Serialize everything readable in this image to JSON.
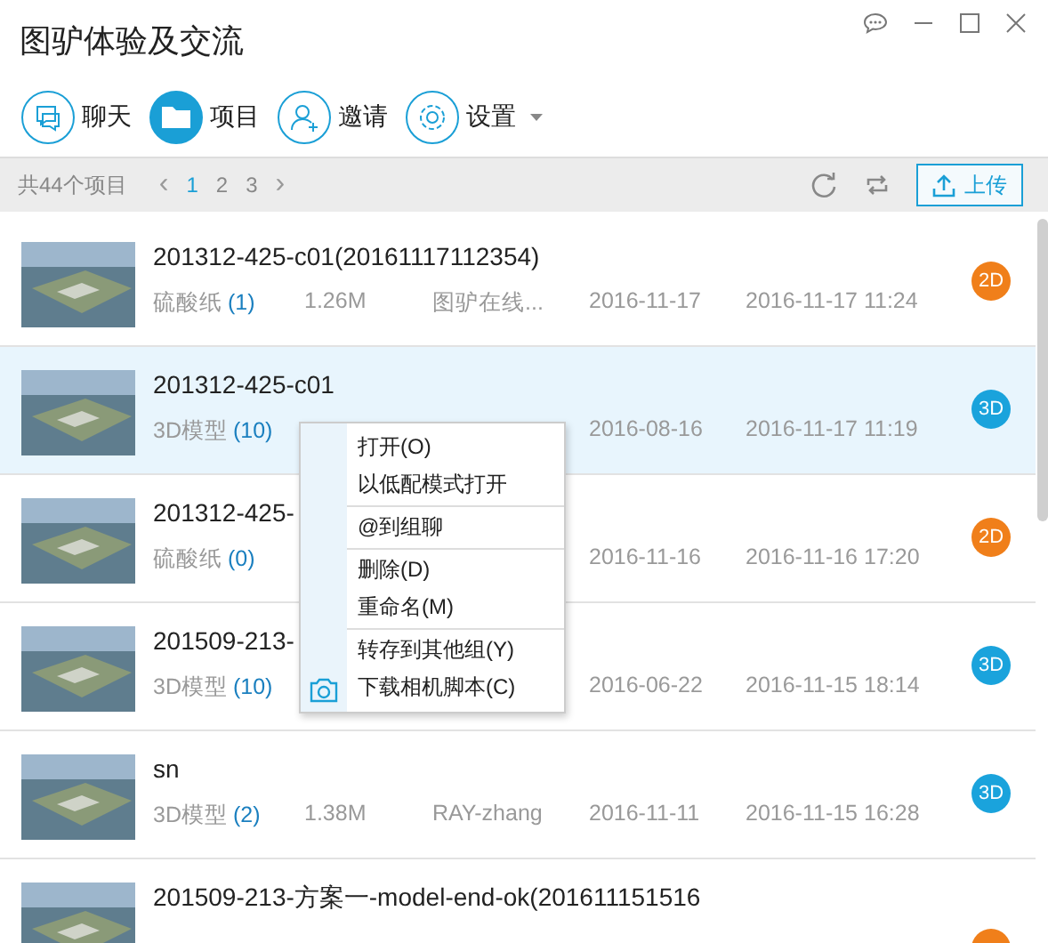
{
  "window": {
    "title": "图驴体验及交流"
  },
  "toolbar": [
    {
      "kind": "chat",
      "label": "聊天",
      "selected": false
    },
    {
      "kind": "folder",
      "label": "项目",
      "selected": true
    },
    {
      "kind": "invite",
      "label": "邀请",
      "selected": false
    },
    {
      "kind": "settings",
      "label": "设置",
      "selected": false,
      "dropdown": true
    }
  ],
  "listbar": {
    "count": "共44个项目",
    "prev": "‹",
    "pages": [
      {
        "label": "1",
        "selected": true
      },
      {
        "label": "2",
        "selected": false
      },
      {
        "label": "3",
        "selected": false
      }
    ],
    "next": "›",
    "upload": "上传"
  },
  "rows": [
    {
      "title": "201312-425-c01(20161117112354)",
      "type": "硫酸纸",
      "count": "(1)",
      "size": "1.26M",
      "owner": "图驴在线...",
      "created": "2016-11-17",
      "modified": "2016-11-17 11:24",
      "badge": {
        "label": "2D",
        "color": "#f07f1a"
      },
      "selected": false
    },
    {
      "title": "201312-425-c01",
      "type": "3D模型",
      "count": "(10)",
      "created": "2016-08-16",
      "modified": "2016-11-17 11:19",
      "badge": {
        "label": "3D",
        "color": "#1aa3dc"
      },
      "selected": true
    },
    {
      "title": "201312-425-",
      "type": "硫酸纸",
      "count": "(0)",
      "created": "2016-11-16",
      "modified": "2016-11-16 17:20",
      "badge": {
        "label": "2D",
        "color": "#f07f1a"
      },
      "selected": false
    },
    {
      "title": "201509-213-",
      "type": "3D模型",
      "count": "(10)",
      "created": "2016-06-22",
      "modified": "2016-11-15 18:14",
      "badge": {
        "label": "3D",
        "color": "#1aa3dc"
      },
      "selected": false
    },
    {
      "title": "sn",
      "type": "3D模型",
      "count": "(2)",
      "size": "1.38M",
      "owner": "RAY-zhang",
      "created": "2016-11-11",
      "modified": "2016-11-15 16:28",
      "badge": {
        "label": "3D",
        "color": "#1aa3dc"
      },
      "selected": false
    },
    {
      "title": "201509-213-方案一-model-end-ok(201611151516",
      "badge": {
        "color": "#f07f1a"
      },
      "selected": false
    }
  ],
  "context_menu": {
    "groups": [
      [
        {
          "label": "打开(O)"
        },
        {
          "label": "以低配模式打开"
        }
      ],
      [
        {
          "label": "@到组聊"
        }
      ],
      [
        {
          "label": "删除(D)"
        },
        {
          "label": "重命名(M)"
        }
      ],
      [
        {
          "label": "转存到其他组(Y)"
        },
        {
          "label": "下载相机脚本(C)",
          "icon": true
        }
      ]
    ]
  }
}
